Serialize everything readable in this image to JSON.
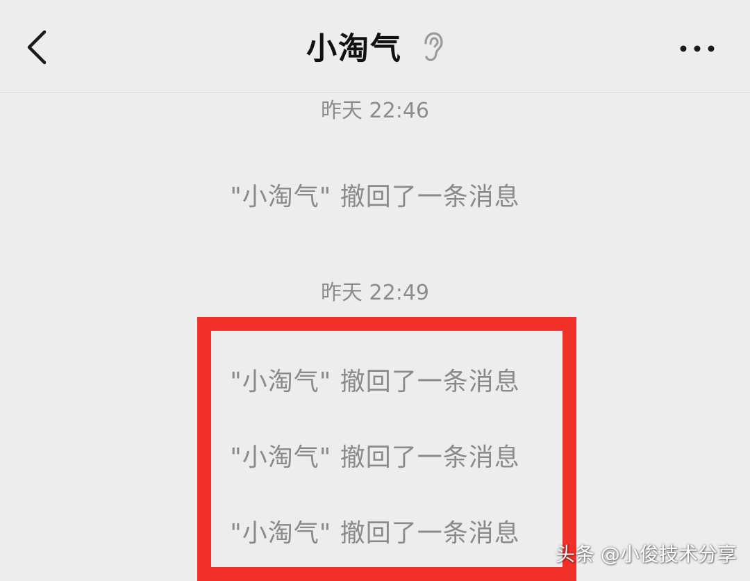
{
  "header": {
    "title": "小淘气",
    "icons": {
      "back": "chevron-left-icon",
      "ear": "ear-icon",
      "more": "more-horizontal-icon"
    }
  },
  "messages": {
    "group1": {
      "timestamp": "昨天 22:46",
      "notices": [
        "\"小淘气\" 撤回了一条消息"
      ]
    },
    "group2": {
      "timestamp": "昨天 22:49",
      "notices": [
        "\"小淘气\" 撤回了一条消息",
        "\"小淘气\" 撤回了一条消息",
        "\"小淘气\" 撤回了一条消息"
      ]
    }
  },
  "watermark": "头条 @小俊技术分享",
  "colors": {
    "background": "#ededed",
    "highlight": "#f2302a",
    "notice_text": "#8a8a8a",
    "title_text": "#111111"
  }
}
